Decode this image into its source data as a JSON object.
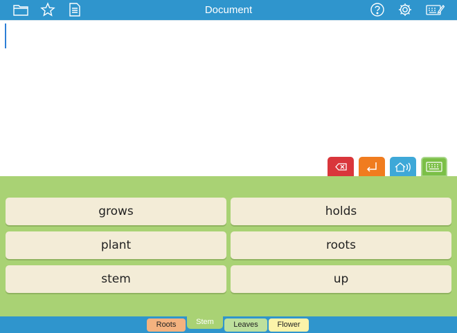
{
  "header": {
    "title": "Document",
    "icons": [
      "folder-icon",
      "star-icon",
      "document-list-icon",
      "help-icon",
      "gear-icon",
      "keyboard-edit-icon"
    ]
  },
  "document": {
    "text": ""
  },
  "actions": {
    "icons": [
      "backspace-icon",
      "return-icon",
      "speak-icon",
      "keyboard-icon"
    ],
    "colors": {
      "delete": "#d9363b",
      "return": "#f07c1f",
      "speak": "#3ea8d8",
      "keyboard": "#7bbf47"
    }
  },
  "words": [
    {
      "label": "grows"
    },
    {
      "label": "holds"
    },
    {
      "label": "plant"
    },
    {
      "label": "roots"
    },
    {
      "label": "stem"
    },
    {
      "label": "up"
    }
  ],
  "tabs": [
    {
      "label": "Roots",
      "color": "#f4b27f"
    },
    {
      "label": "Stem",
      "color": "#a9d274",
      "selected": true
    },
    {
      "label": "Leaves",
      "color": "#bde09d"
    },
    {
      "label": "Flower",
      "color": "#fbf3a9"
    }
  ],
  "theme": {
    "bar": "#2f95cd",
    "panel": "#a9d274",
    "word_button": "#f3ecd7"
  }
}
